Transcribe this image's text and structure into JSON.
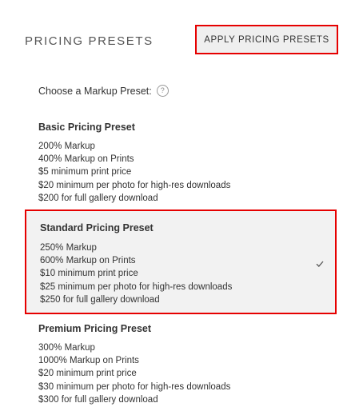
{
  "header": {
    "title": "PRICING PRESETS",
    "apply_label": "APPLY PRICING PRESETS"
  },
  "chooser": {
    "label": "Choose a Markup Preset:",
    "help_glyph": "?"
  },
  "presets": [
    {
      "name": "Basic Pricing Preset",
      "selected": false,
      "lines": [
        "200% Markup",
        "400% Markup on Prints",
        "$5 minimum print price",
        "$20 minimum per photo for high-res downloads",
        "$200 for full gallery download"
      ]
    },
    {
      "name": "Standard Pricing Preset",
      "selected": true,
      "lines": [
        "250% Markup",
        "600% Markup on Prints",
        "$10 minimum print price",
        "$25 minimum per photo for high-res downloads",
        "$250 for full gallery download"
      ]
    },
    {
      "name": "Premium Pricing Preset",
      "selected": false,
      "lines": [
        "300% Markup",
        "1000% Markup on Prints",
        "$20 minimum print price",
        "$30 minimum per photo for high-res downloads",
        "$300 for full gallery download"
      ]
    }
  ],
  "colors": {
    "highlight_border": "#e60000",
    "selected_background": "#f2f2f2",
    "button_background": "#efefef"
  }
}
